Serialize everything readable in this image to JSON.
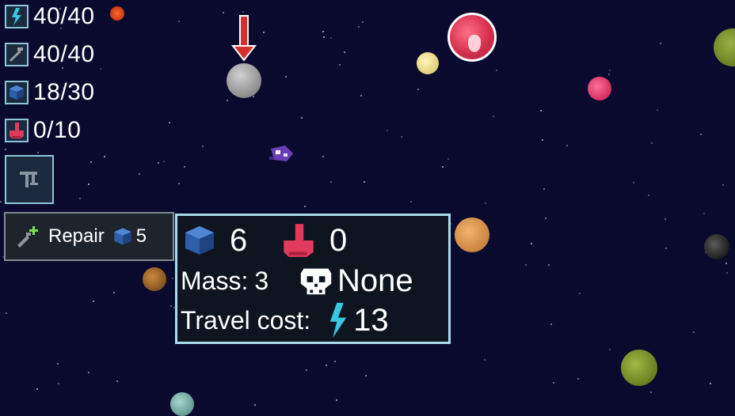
{
  "hud": {
    "energy": {
      "icon": "lightning-icon",
      "value": "40/40"
    },
    "hull": {
      "icon": "wrench-icon",
      "value": "40/40"
    },
    "resources": {
      "icon": "cube-icon",
      "value": "18/30"
    },
    "population": {
      "icon": "hand-icon",
      "value": "0/10"
    },
    "build_button_icon": "build-icon"
  },
  "repair_button": {
    "label": "Repair",
    "cost": "5",
    "icon": "repair-wrench-icon"
  },
  "planet_info": {
    "resources": "6",
    "population": "0",
    "mass_label": "Mass:",
    "mass_value": "3",
    "threat_icon": "skull-icon",
    "threat_value": "None",
    "travel_label": "Travel cost:",
    "travel_value": "13"
  },
  "colors": {
    "background": "#0a0a2e",
    "panel_border": "#a8dcec",
    "energy": "#39c6e0",
    "resource_cube": "#2d5fa8",
    "population": "#e03a5c",
    "marker_arrow": "#d62e2e"
  }
}
